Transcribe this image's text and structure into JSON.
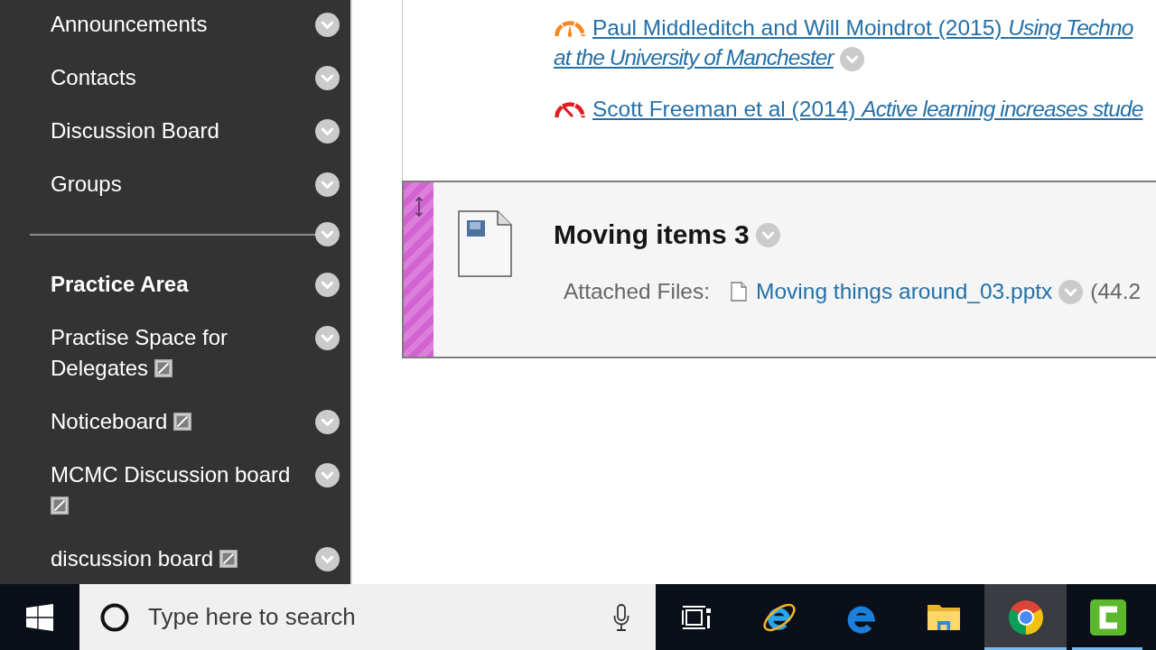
{
  "sidebar": {
    "items": [
      {
        "kind": "link",
        "label": "Announcements",
        "hidden": false
      },
      {
        "kind": "link",
        "label": "Contacts",
        "hidden": false
      },
      {
        "kind": "link",
        "label": "Discussion Board",
        "hidden": false
      },
      {
        "kind": "link",
        "label": "Groups",
        "hidden": false
      },
      {
        "kind": "divider"
      },
      {
        "kind": "heading",
        "label": "Practice Area",
        "hidden": false
      },
      {
        "kind": "link",
        "label": "Practise Space for Delegates",
        "hidden": true
      },
      {
        "kind": "link",
        "label": "Noticeboard",
        "hidden": true
      },
      {
        "kind": "link",
        "label": "MCMC Discussion board",
        "hidden": true
      },
      {
        "kind": "link",
        "label": "discussion board",
        "hidden": true
      }
    ]
  },
  "content_items": [
    {
      "kind": "links",
      "selected": false,
      "links": [
        {
          "kind": "medium",
          "color": "#f5891f",
          "text": "Paul Middleditch and Will Moindrot (2015) *Using Techno*\n*at the University of Manchester*",
          "menu_button": true
        },
        {
          "kind": "high",
          "color": "#e01b22",
          "text": "Scott Freeman et al (2014) *Active learning increases stude*",
          "menu_button": false
        }
      ]
    },
    {
      "kind": "file",
      "selected": true,
      "title": "Moving items 3",
      "attachment": {
        "label": "Attached Files:",
        "file": "Moving things around_03.pptx",
        "size": "(44.2"
      }
    }
  ],
  "taskbar": {
    "search": {
      "placeholder": "Type here to search"
    },
    "apps": [
      {
        "kind": "taskview",
        "selected": false,
        "running": false
      },
      {
        "kind": "ie",
        "selected": false,
        "running": false
      },
      {
        "kind": "edge",
        "selected": false,
        "running": false
      },
      {
        "kind": "folder",
        "selected": false,
        "running": false
      },
      {
        "kind": "chrome",
        "selected": true,
        "running": true
      },
      {
        "kind": "camtasia",
        "selected": false,
        "running": true
      }
    ]
  }
}
